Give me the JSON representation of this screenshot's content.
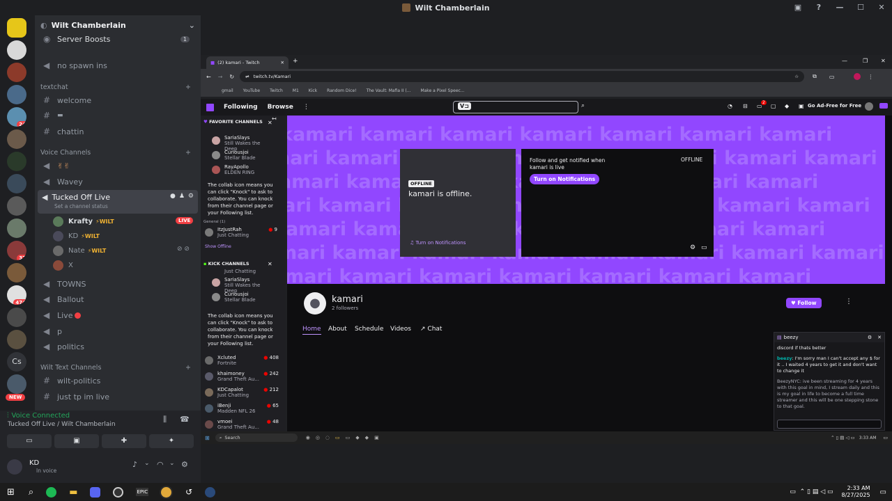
{
  "window": {
    "title": "Wilt Chamberlain"
  },
  "servers": [
    {
      "name": "server-1",
      "badge": ""
    },
    {
      "name": "server-2",
      "badge": ""
    },
    {
      "name": "server-3",
      "badge": ""
    },
    {
      "name": "server-4",
      "badge": "24"
    },
    {
      "name": "server-5",
      "badge": ""
    },
    {
      "name": "server-6",
      "badge": ""
    },
    {
      "name": "server-7",
      "badge": ""
    },
    {
      "name": "server-8",
      "badge": ""
    },
    {
      "name": "server-9",
      "badge": ""
    },
    {
      "name": "server-10",
      "badge": "37"
    },
    {
      "name": "server-11",
      "badge": ""
    },
    {
      "name": "server-12",
      "badge": "474"
    },
    {
      "name": "server-13",
      "badge": ""
    },
    {
      "name": "server-14",
      "badge": ""
    },
    {
      "name": "cs-server",
      "badge": ""
    },
    {
      "name": "server-16",
      "badge": ""
    },
    {
      "name": "new-server",
      "badge": "NEW"
    }
  ],
  "server_short": "Cs",
  "channels": {
    "server_name": "Wilt Chamberlain",
    "server_boosts": "Server Boosts",
    "boost_count": "1",
    "no_spawn": "no spawn ins",
    "cat_textchat": "textchat",
    "welcome": "welcome",
    "chattin": "chattin",
    "cat_voice": "Voice Channels",
    "wavey": "Wavey",
    "tucked_off": "Tucked Off Live",
    "set_status": "Set a channel status",
    "members": [
      {
        "name": "Krafty",
        "tag": "WILT",
        "live": "LIVE"
      },
      {
        "name": "KD",
        "tag": "WILT",
        "live": ""
      },
      {
        "name": "Nate",
        "tag": "WILT",
        "live": ""
      },
      {
        "name": "X",
        "tag": "",
        "live": ""
      }
    ],
    "towns": "TOWNS",
    "ballout": "Ballout",
    "live": "Live",
    "p": "p",
    "politics": "politics",
    "cat_wilt_text": "Wilt Text Channels",
    "wilt_politics": "wilt-politics",
    "just_tp": "just tp im live"
  },
  "voice": {
    "status": "Voice Connected",
    "location": "Tucked Off Live / Wilt Chamberlain",
    "user": "KD",
    "user_status": "In voice"
  },
  "browser": {
    "tab_title": "(2) kamari - Twitch",
    "url": "twitch.tv/Kamari",
    "bookmarks": [
      "gmail",
      "YouTube",
      "Twitch",
      "M1",
      "Kick",
      "Random Dice!",
      "The Vault: Mafia II (...",
      "Make a Pixel Speec..."
    ]
  },
  "twitch": {
    "nav_following": "Following",
    "nav_browse": "Browse",
    "ad_free": "Go Ad-Free for Free",
    "notif_count": "2",
    "fav_header": "FAVORITE CHANNELS",
    "fav_items": [
      {
        "name": "SariaSlays",
        "game": "Still Wakes the Deep"
      },
      {
        "name": "Curiousjoi",
        "game": "Stellar Blade"
      },
      {
        "name": "RayApollo",
        "game": "ELDEN RING"
      }
    ],
    "collab_text": "The collab icon means you can click \"Knock\" to ask to collaborate. You can knock from their channel page or your Following list.",
    "general_label": "General (1)",
    "itz": {
      "name": "ItzJustRah",
      "game": "Just Chatting",
      "count": "9"
    },
    "show_offline": "Show Offline",
    "kick_header": "KICK CHANNELS",
    "kick_items": [
      {
        "name": "",
        "game": "Just Chatting"
      },
      {
        "name": "SariaSlays",
        "game": "Still Wakes the Deep"
      },
      {
        "name": "Curiousjoi",
        "game": "Stellar Blade"
      }
    ],
    "collab_text2": "The collab icon means you can click \"Knock\" to ask to collaborate. You can knock from their channel page or your Following list.",
    "live_list": [
      {
        "name": "Xcluted",
        "game": "Fortnite",
        "count": "408"
      },
      {
        "name": "khaimoney",
        "game": "Grand Theft Au...",
        "count": "242"
      },
      {
        "name": "KDCapalot",
        "game": "Just Chatting",
        "count": "212"
      },
      {
        "name": "iBenji",
        "game": "Madden NFL 26",
        "count": "65"
      },
      {
        "name": "vmoei",
        "game": "Grand Theft Au...",
        "count": "48"
      }
    ],
    "watermark": "kamari",
    "offline_badge": "OFFLINE",
    "offline_text": "kamari is offline.",
    "turn_on": "Turn on Notifications",
    "follow_text": "Follow and get notified when kamari is live",
    "turn_on_btn": "Turn on Notifications",
    "offline_tag": "OFFLINE",
    "channel_name": "kamari",
    "followers": "2 followers",
    "follow_btn": "Follow",
    "tabs": [
      "Home",
      "About",
      "Schedule",
      "Videos",
      "Chat"
    ]
  },
  "chat": {
    "title": "beezy",
    "messages": [
      {
        "user": "",
        "text": "discord if thats better"
      },
      {
        "user": "beezy",
        "text": ": I'm sorry man I can't accept any $ for it .. I waited 4 years to get it and don't want to change it"
      },
      {
        "user": "BeezyNYC",
        "text": ": ive been streaming for 4 years with this goal in mind, I stream daily and this is my goal in life to become a full time streamer and this will be one stepping stone to that goal."
      }
    ]
  },
  "inner_taskbar": {
    "search": "Search",
    "time": "3:33 AM"
  },
  "taskbar": {
    "time": "2:33 AM",
    "date": "8/27/2025"
  },
  "colors": {
    "discord_bg": "#2b2d31",
    "twitch_purple": "#9147ff",
    "live_red": "#f23f43",
    "voice_green": "#23a55a"
  }
}
